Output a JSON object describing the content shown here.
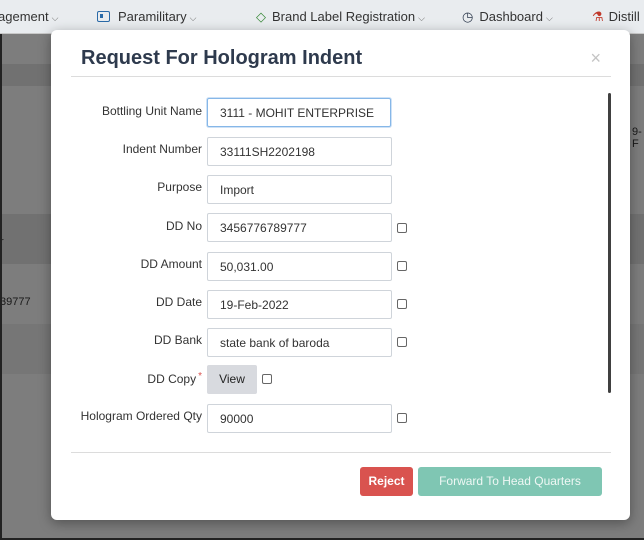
{
  "topnav": {
    "items": [
      {
        "label": "agement"
      },
      {
        "label": "Paramilitary"
      },
      {
        "label": "Brand Label Registration"
      },
      {
        "label": "Dashboard"
      },
      {
        "label": "Distill"
      }
    ]
  },
  "background": {
    "col_fragment": "r",
    "row_fragment": "39777",
    "side_fragment": "9-F"
  },
  "modal": {
    "title": "Request For Hologram Indent",
    "close_icon": "×",
    "fields": [
      {
        "label": "Bottling Unit Name",
        "value": "3111 - MOHIT ENTERPRISE"
      },
      {
        "label": "Indent Number",
        "value": "33111SH2202198"
      },
      {
        "label": "Purpose",
        "value": "Import"
      },
      {
        "label": "DD No",
        "value": "3456776789777"
      },
      {
        "label": "DD Amount",
        "value": "50,031.00"
      },
      {
        "label": "DD Date",
        "value": "19-Feb-2022"
      },
      {
        "label": "DD Bank",
        "value": "state bank of baroda"
      },
      {
        "label": "DD Copy",
        "required_mark": "*",
        "button": "View"
      },
      {
        "label": "Hologram Ordered Qty",
        "value": "90000"
      }
    ],
    "buttons": {
      "reject": "Reject",
      "forward": "Forward To Head Quarters"
    }
  },
  "colors": {
    "reject": "#d9534f",
    "forward": "#7fc6b3",
    "title": "#2e3a4d",
    "required": "#d9534f"
  },
  "icons": [
    "chevron-down-icon",
    "id-card-icon",
    "tag-icon",
    "dashboard-icon",
    "flask-icon",
    "close-icon",
    "checkbox"
  ]
}
